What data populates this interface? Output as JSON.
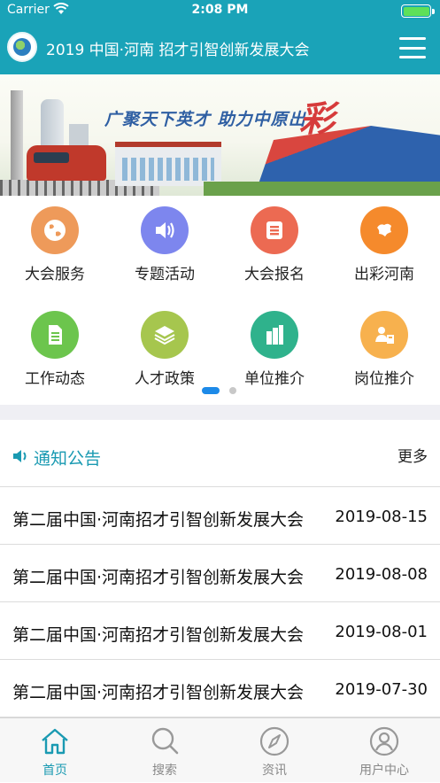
{
  "status_bar": {
    "carrier": "Carrier",
    "time": "2:08 PM"
  },
  "nav": {
    "title": "2019 中国·河南 招才引智创新发展大会"
  },
  "banner": {
    "headline": "广聚天下英才 助力中原出",
    "headline_accent": "彩"
  },
  "grid": {
    "items": [
      {
        "label": "大会服务",
        "icon": "globe-icon",
        "color": "#ee9a5a"
      },
      {
        "label": "专题活动",
        "icon": "speaker-icon",
        "color": "#7d86ee"
      },
      {
        "label": "大会报名",
        "icon": "form-icon",
        "color": "#ec6a52"
      },
      {
        "label": "出彩河南",
        "icon": "henan-map-icon",
        "color": "#f58a2c"
      },
      {
        "label": "工作动态",
        "icon": "document-icon",
        "color": "#6cc54d"
      },
      {
        "label": "人才政策",
        "icon": "layers-icon",
        "color": "#a6c64e"
      },
      {
        "label": "单位推介",
        "icon": "building-icon",
        "color": "#2fb28c"
      },
      {
        "label": "岗位推介",
        "icon": "worker-icon",
        "color": "#f7b14e"
      }
    ]
  },
  "notice": {
    "title": "通知公告",
    "more": "更多",
    "items": [
      {
        "text": "第二届中国·河南招才引智创新发展大会",
        "date": "2019-08-15"
      },
      {
        "text": "第二届中国·河南招才引智创新发展大会",
        "date": "2019-08-08"
      },
      {
        "text": "第二届中国·河南招才引智创新发展大会",
        "date": "2019-08-01"
      },
      {
        "text": "第二届中国·河南招才引智创新发展大会",
        "date": "2019-07-30"
      }
    ]
  },
  "tabbar": {
    "items": [
      {
        "label": "首页",
        "icon": "home-icon",
        "active": true
      },
      {
        "label": "搜索",
        "icon": "search-icon",
        "active": false
      },
      {
        "label": "资讯",
        "icon": "compass-icon",
        "active": false
      },
      {
        "label": "用户中心",
        "icon": "user-icon",
        "active": false
      }
    ]
  },
  "colors": {
    "brand": "#1aa3b8",
    "active_tab": "#1a9ab2",
    "pager_active": "#1d8ae8"
  }
}
